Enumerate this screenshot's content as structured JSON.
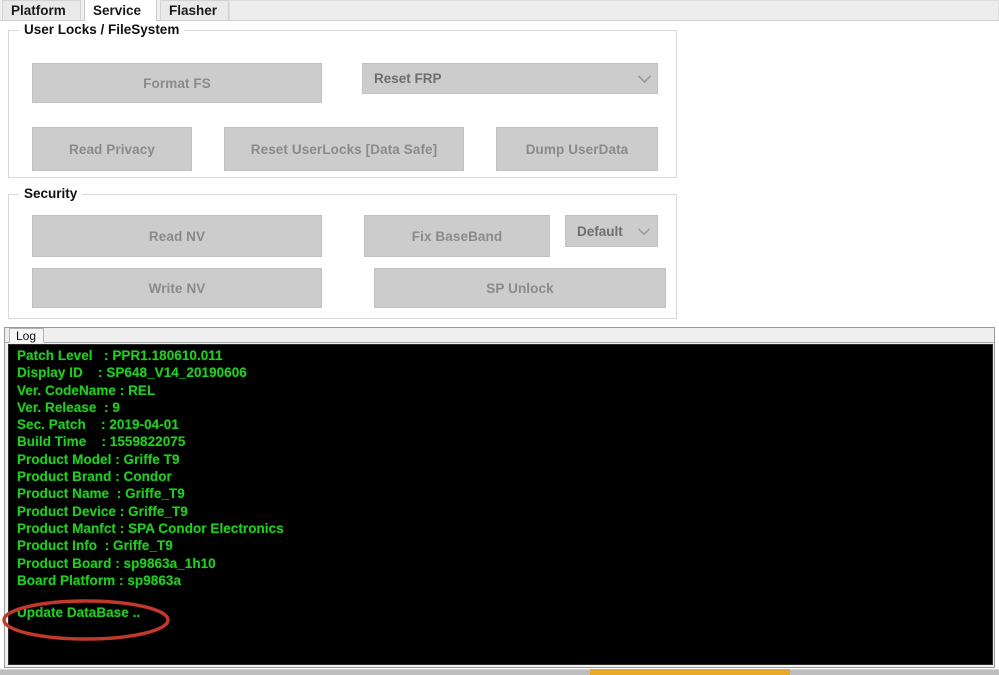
{
  "window": {
    "tabs": [
      {
        "label": "Platform",
        "active": false
      },
      {
        "label": "Service",
        "active": true
      },
      {
        "label": "Flasher",
        "active": false
      }
    ]
  },
  "groups": {
    "user_locks": {
      "title": "User Locks  / FileSystem",
      "buttons": [
        {
          "label": "Format FS"
        },
        {
          "label": "Read Privacy"
        },
        {
          "label": "Reset UserLocks [Data Safe]"
        },
        {
          "label": "Dump UserData"
        }
      ],
      "combo": {
        "value": "Reset FRP",
        "icon": "chevron-down-icon"
      }
    },
    "security": {
      "title": "Security",
      "buttons": [
        {
          "label": "Read NV"
        },
        {
          "label": "Write NV"
        },
        {
          "label": "Fix BaseBand"
        },
        {
          "label": "SP Unlock"
        }
      ],
      "combo": {
        "value": "Default",
        "icon": "chevron-down-icon"
      }
    }
  },
  "log": {
    "tab_label": "Log",
    "lines": [
      "Patch Level   : PPR1.180610.011",
      "Display ID    : SP648_V14_20190606",
      "Ver. CodeName : REL",
      "Ver. Release  : 9",
      "Sec. Patch    : 2019-04-01",
      "Build Time    : 1559822075",
      "Product Model : Griffe T9",
      "Product Brand : Condor",
      "Product Name  : Griffe_T9",
      "Product Device : Griffe_T9",
      "Product Manfct : SPA Condor Electronics",
      "Product Info  : Griffe_T9",
      "Product Board : sp9863a_1h10",
      "Board Platform : sp9863a"
    ],
    "highlighted_line": "Update DataBase ..",
    "text_color": "#22cc22",
    "background_color": "#000000",
    "annotation_color": "#c0392b"
  },
  "status": {
    "progress_color": "#e8a828",
    "track_color": "#bdbdbd"
  }
}
